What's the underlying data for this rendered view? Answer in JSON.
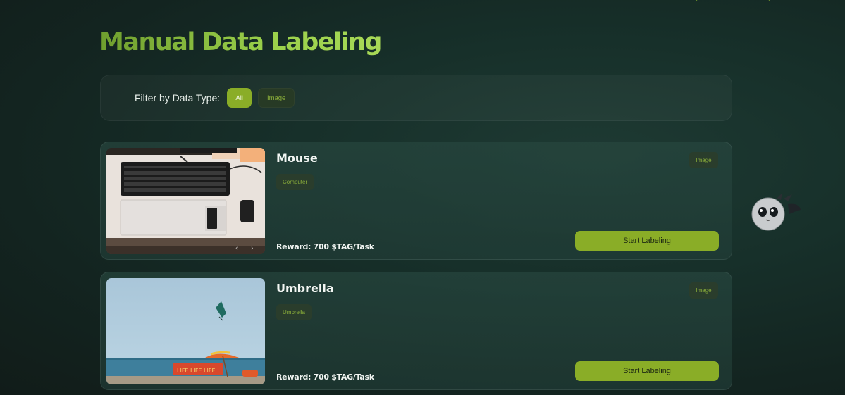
{
  "page": {
    "title": "Manual Data Labeling"
  },
  "filter": {
    "label": "Filter by Data Type:",
    "options": [
      {
        "label": "All",
        "active": true
      },
      {
        "label": "Image",
        "active": false
      }
    ]
  },
  "tasks": [
    {
      "title": "Mouse",
      "tag": "Computer",
      "type": "Image",
      "reward": "Reward: 700 $TAG/Task",
      "button": "Start Labeling",
      "image_icon": "keyboard-desk-photo"
    },
    {
      "title": "Umbrella",
      "tag": "Umbrella",
      "type": "Image",
      "reward": "Reward: 700 $TAG/Task",
      "button": "Start Labeling",
      "image_icon": "beach-umbrella-photo"
    }
  ],
  "colors": {
    "accent": "#8aad27",
    "title_green": "#8dc63f",
    "chip_bg": "#2a3d2c",
    "chip_text": "#8aad3a"
  }
}
